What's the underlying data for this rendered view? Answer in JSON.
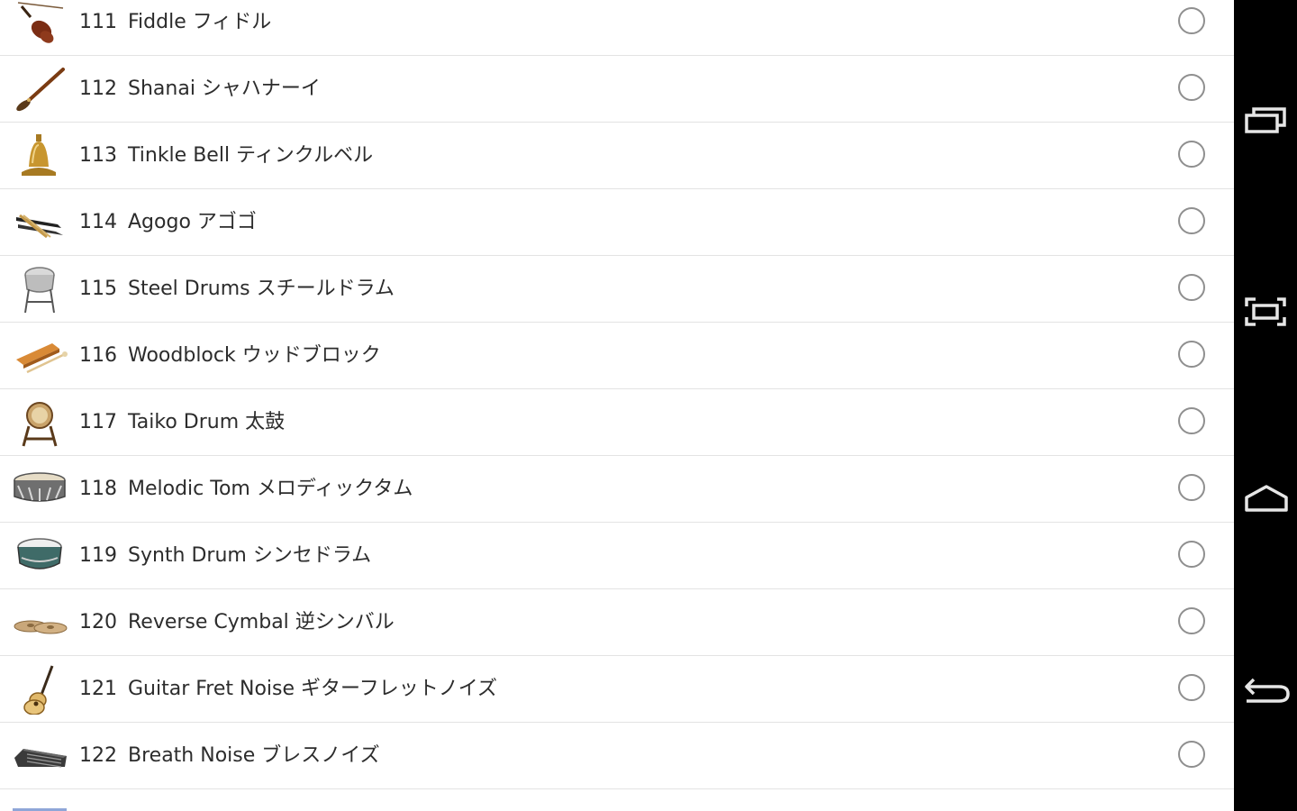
{
  "instruments": [
    {
      "number": "111",
      "name": "Fiddle フィドル",
      "icon": "fiddle-icon"
    },
    {
      "number": "112",
      "name": "Shanai シャハナーイ",
      "icon": "shanai-icon"
    },
    {
      "number": "113",
      "name": "Tinkle Bell ティンクルベル",
      "icon": "bell-icon"
    },
    {
      "number": "114",
      "name": "Agogo アゴゴ",
      "icon": "agogo-icon"
    },
    {
      "number": "115",
      "name": "Steel Drums スチールドラム",
      "icon": "steel-drum-icon"
    },
    {
      "number": "116",
      "name": "Woodblock ウッドブロック",
      "icon": "woodblock-icon"
    },
    {
      "number": "117",
      "name": "Taiko Drum 太鼓",
      "icon": "taiko-drum-icon"
    },
    {
      "number": "118",
      "name": "Melodic Tom メロディックタム",
      "icon": "tom-drum-icon"
    },
    {
      "number": "119",
      "name": "Synth Drum シンセドラム",
      "icon": "synth-drum-icon"
    },
    {
      "number": "120",
      "name": "Reverse Cymbal 逆シンバル",
      "icon": "cymbal-icon"
    },
    {
      "number": "121",
      "name": "Guitar Fret Noise ギターフレットノイズ",
      "icon": "guitar-icon"
    },
    {
      "number": "122",
      "name": "Breath Noise ブレスノイズ",
      "icon": "breath-noise-icon"
    }
  ],
  "navigation": {
    "recent_apps_icon": "recent-apps-icon",
    "screenshot_icon": "screenshot-icon",
    "home_icon": "home-icon",
    "back_icon": "back-icon"
  },
  "colors": {
    "background": "#ffffff",
    "divider": "#e3e3e3",
    "text": "#2c2c2c",
    "radio_border": "#8f8f8f",
    "navbar": "#000000"
  }
}
